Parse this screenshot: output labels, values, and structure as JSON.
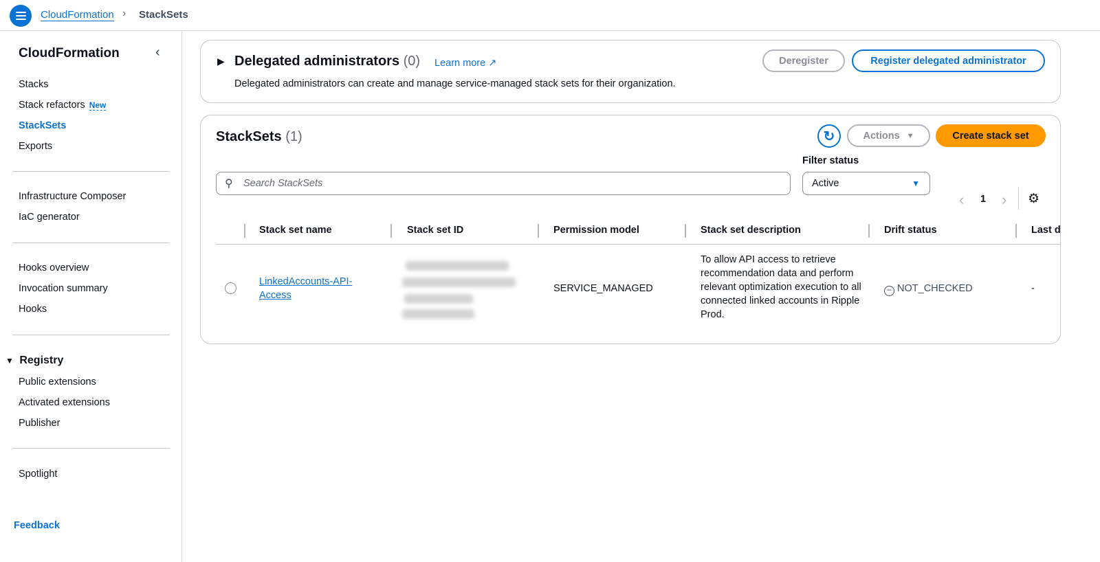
{
  "header": {
    "breadcrumb": [
      "CloudFormation",
      "StackSets"
    ]
  },
  "sidebar": {
    "title": "CloudFormation",
    "items": [
      {
        "label": "Stacks"
      },
      {
        "label": "Stack refactors",
        "badge": "New"
      },
      {
        "label": "StackSets",
        "active": true
      },
      {
        "label": "Exports"
      },
      {
        "label": "Infrastructure Composer"
      },
      {
        "label": "IaC generator"
      },
      {
        "label": "Hooks overview"
      },
      {
        "label": "Invocation summary"
      },
      {
        "label": "Hooks"
      }
    ],
    "registry": {
      "label": "Registry",
      "items": [
        "Public extensions",
        "Activated extensions",
        "Publisher"
      ]
    },
    "spotlight": "Spotlight",
    "feedback": "Feedback"
  },
  "delegated": {
    "title": "Delegated administrators",
    "count": "(0)",
    "learn_more": "Learn more",
    "description": "Delegated administrators can create and manage service-managed stack sets for their organization.",
    "deregister": "Deregister",
    "register": "Register delegated administrator"
  },
  "stacksets": {
    "title": "StackSets",
    "count": "(1)",
    "actions": "Actions",
    "create": "Create stack set",
    "search_placeholder": "Search StackSets",
    "filter_label": "Filter status",
    "filter_value": "Active",
    "page": "1",
    "columns": [
      "Stack set name",
      "Stack set ID",
      "Permission model",
      "Stack set description",
      "Drift status",
      "Last d"
    ],
    "rows": [
      {
        "name": "LinkedAccounts-API-Access",
        "permission_model": "SERVICE_MANAGED",
        "description": "To allow API access to retrieve recommendation data and perform relevant optimization execution to all connected linked accounts in Ripple Prod.",
        "drift_status": "NOT_CHECKED",
        "last": "-"
      }
    ]
  },
  "colors": {
    "accent": "#0972d3",
    "primary_button": "#ff9900"
  }
}
